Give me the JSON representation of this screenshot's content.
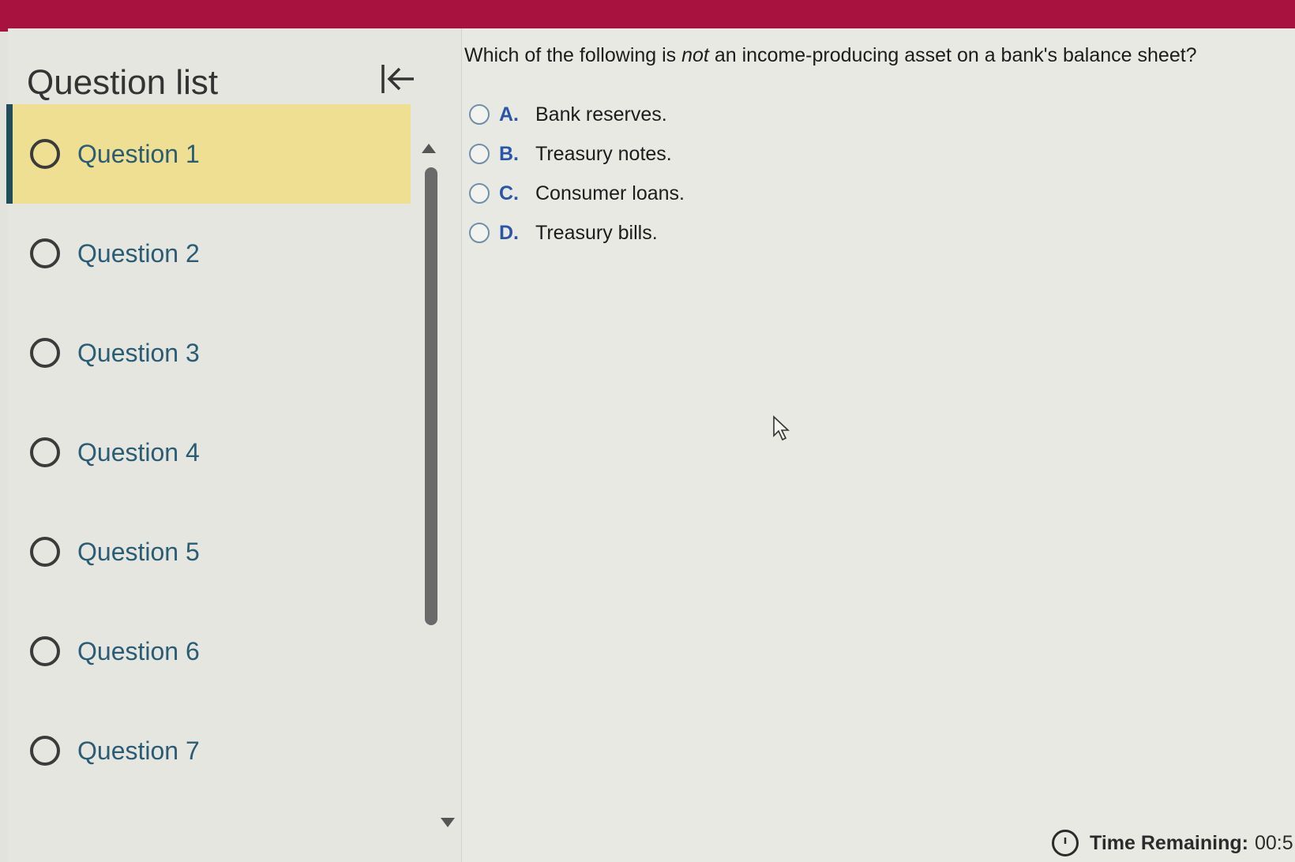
{
  "sidebar": {
    "title": "Question list",
    "questions": [
      {
        "label": "Question 1",
        "active": true
      },
      {
        "label": "Question 2",
        "active": false
      },
      {
        "label": "Question 3",
        "active": false
      },
      {
        "label": "Question 4",
        "active": false
      },
      {
        "label": "Question 5",
        "active": false
      },
      {
        "label": "Question 6",
        "active": false
      },
      {
        "label": "Question 7",
        "active": false
      }
    ]
  },
  "question": {
    "text_before": "Which of the following is ",
    "text_emphasis": "not",
    "text_after": " an income-producing asset on a bank's balance sheet?",
    "options": [
      {
        "letter": "A.",
        "text": "Bank reserves."
      },
      {
        "letter": "B.",
        "text": "Treasury notes."
      },
      {
        "letter": "C.",
        "text": "Consumer loans."
      },
      {
        "letter": "D.",
        "text": "Treasury bills."
      }
    ]
  },
  "timer": {
    "label": "Time Remaining:",
    "value": "00:5"
  },
  "colors": {
    "brand_bar": "#a8123f",
    "active_item": "#eedf92",
    "active_marker": "#1f4d5a",
    "question_link": "#2a5c74",
    "option_letter": "#2c55a8"
  }
}
